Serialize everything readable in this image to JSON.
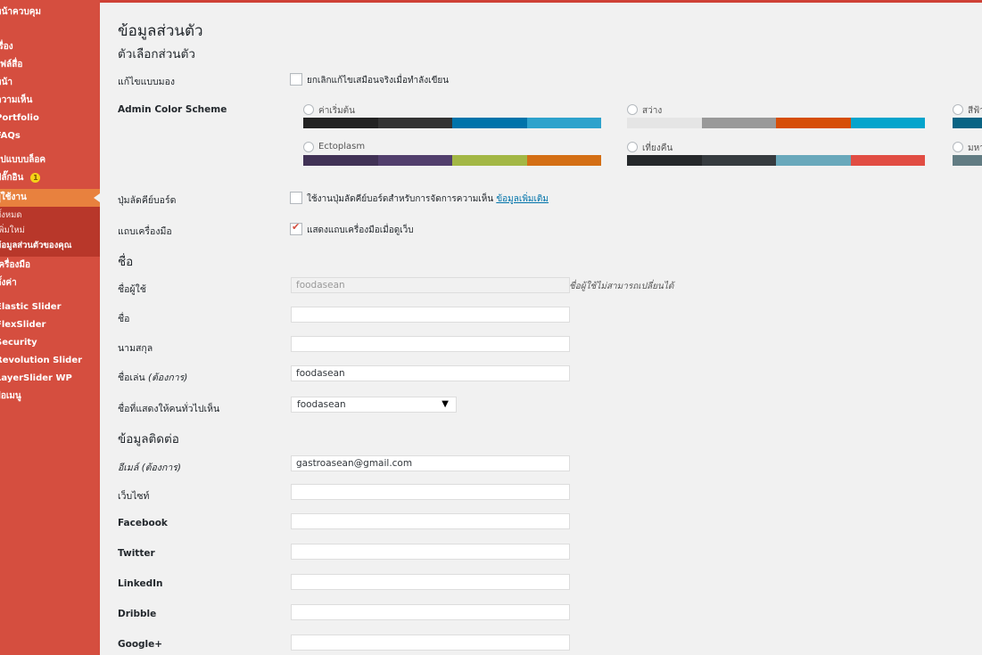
{
  "sidebar": {
    "items": [
      {
        "label": "หน้าควบคุม"
      },
      {
        "label": "เรื่อง"
      },
      {
        "label": "ไฟล์สื่อ"
      },
      {
        "label": "หน้า"
      },
      {
        "label": "ความเห็น"
      },
      {
        "label": "Portfolio"
      },
      {
        "label": "FAQs"
      },
      {
        "label": "รูปแบบบล็อค"
      },
      {
        "label": "ปลั๊กอิน",
        "badge": "1"
      },
      {
        "label": "ผู้ใช้งาน"
      },
      {
        "label": "เครื่องมือ"
      },
      {
        "label": "ตั้งค่า"
      },
      {
        "label": "Elastic Slider"
      },
      {
        "label": "FlexSlider"
      },
      {
        "label": "Security"
      },
      {
        "label": "Revolution Slider"
      },
      {
        "label": "LayerSlider WP"
      },
      {
        "label": "ย่อเมนู"
      }
    ],
    "submenu": [
      {
        "label": "ทั้งหมด"
      },
      {
        "label": "เพิ่มใหม่"
      },
      {
        "label": "ข้อมูลส่วนตัวของคุณ"
      }
    ]
  },
  "page": {
    "title": "ข้อมูลส่วนตัว",
    "section_personal": "ตัวเลือกส่วนตัว",
    "section_name": "ชื่อ",
    "section_contact": "ข้อมูลติดต่อ"
  },
  "options": {
    "visual_editor_label": "แก้ไขแบบมอง",
    "visual_editor_text": "ยกเลิกแก้ไขเสมือนจริงเมื่อทำลังเขียน",
    "color_scheme_label": "Admin Color Scheme",
    "schemes": [
      {
        "name": "ค่าเริ่มต้น",
        "colors": [
          "#222222",
          "#333333",
          "#0073aa",
          "#2ea2cc"
        ]
      },
      {
        "name": "สว่าง",
        "colors": [
          "#e5e5e5",
          "#999999",
          "#d64e07",
          "#04a4cc"
        ]
      },
      {
        "name": "สีฟ้า",
        "colors": [
          "#096484",
          "#4796b3",
          "#52accc",
          "#74b6ce"
        ]
      },
      {
        "name": "Ectoplasm",
        "colors": [
          "#413256",
          "#523f6d",
          "#a3b745",
          "#d46f15"
        ]
      },
      {
        "name": "เที่ยงคืน",
        "colors": [
          "#25282b",
          "#363b3f",
          "#69a8bb",
          "#e14d43"
        ]
      },
      {
        "name": "มหาสมุทร",
        "colors": [
          "#627c83",
          "#738e96",
          "#9ebaa0",
          "#aa9d88"
        ]
      }
    ],
    "shortcuts_label": "ปุ่มลัดคีย์บอร์ด",
    "shortcuts_text": "ใช้งานปุ่มลัดคีย์บอร์ดสำหรับการจัดการความเห็น",
    "shortcuts_link": "ข้อมูลเพิ่มเติม",
    "toolbar_label": "แถบเครื่องมือ",
    "toolbar_text": "แสดงแถบเครื่องมือเมื่อดูเว็บ"
  },
  "name_fields": {
    "username_label": "ชื่อผู้ใช้",
    "username_value": "foodasean",
    "username_desc": "ชื่อผู้ใช้ไม่สามารถเปลี่ยนได้",
    "first_name_label": "ชื่อ",
    "first_name_value": "",
    "last_name_label": "นามสกุล",
    "last_name_value": "",
    "nickname_label": "ชื่อเล่น",
    "nickname_required": "(ต้องการ)",
    "nickname_value": "foodasean",
    "display_label": "ชื่อที่แสดงให้คนทั่วไปเห็น",
    "display_value": "foodasean"
  },
  "contact_fields": {
    "email_label": "อีเมล์",
    "email_required": "(ต้องการ)",
    "email_value": "gastroasean@gmail.com",
    "website_label": "เว็บไซท์",
    "website_value": "",
    "facebook_label": "Facebook",
    "facebook_value": "",
    "twitter_label": "Twitter",
    "twitter_value": "",
    "linkedin_label": "LinkedIn",
    "linkedin_value": "",
    "dribble_label": "Dribble",
    "dribble_value": "",
    "google_label": "Google+",
    "google_value": ""
  }
}
